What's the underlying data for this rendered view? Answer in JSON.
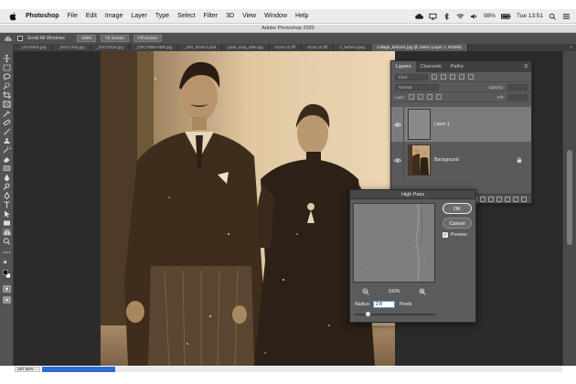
{
  "menubar": {
    "app_name": "Photoshop",
    "items": [
      "File",
      "Edit",
      "Image",
      "Layer",
      "Type",
      "Select",
      "Filter",
      "3D",
      "View",
      "Window",
      "Help"
    ],
    "battery": "98%",
    "clock": "Tue 13:51"
  },
  "window": {
    "title": "Adobe Photoshop 2020"
  },
  "options_bar": {
    "scroll_all_label": "Scroll All Windows",
    "zoom_value": "100%",
    "fit_screen_label": "Fit Screen",
    "fill_screen_label": "Fill Screen"
  },
  "tabs": [
    {
      "label": "_UCH93dc.jpg",
      "active": false
    },
    {
      "label": "_DSC1343.jpg",
      "active": false
    },
    {
      "label": "_DSC2419.jpg",
      "active": false
    },
    {
      "label": "_DSC7596-HDR.jpg",
      "active": false
    },
    {
      "label": "_MG_8244-2.psd",
      "active": false
    },
    {
      "label": "grad_map_after.jpg",
      "active": false
    },
    {
      "label": "Scan 11.tiff",
      "active": false
    },
    {
      "label": "Scan 10.tiff",
      "active": false
    },
    {
      "label": "2_before.jpeg",
      "active": false
    },
    {
      "label": "collage_before1.jpg @ 158% (Layer 1, RGB/8)",
      "active": true
    }
  ],
  "status": {
    "zoom": "167.66%"
  },
  "layers_panel": {
    "tabs": [
      "Layers",
      "Channels",
      "Paths"
    ],
    "kind_placeholder": "Kind",
    "blend_mode": "Normal",
    "opacity_label": "Opacity:",
    "fill_label": "Fill:",
    "lock_label": "Lock:",
    "layers": [
      {
        "name": "Layer 1",
        "selected": true
      },
      {
        "name": "Background",
        "selected": false
      }
    ]
  },
  "dialog": {
    "title": "High Pass",
    "ok_label": "OK",
    "cancel_label": "Cancel",
    "preview_label": "Preview",
    "preview_checked": true,
    "zoom_value": "100%",
    "radius_label": "Radius:",
    "radius_value": "2.8",
    "radius_unit": "Pixels"
  },
  "colors": {
    "accent_blue": "#2f6dd4",
    "panel_gray": "#5a5a5a",
    "canvas_dark": "#2b2b2b",
    "photo_sepia": "#c8a278"
  }
}
